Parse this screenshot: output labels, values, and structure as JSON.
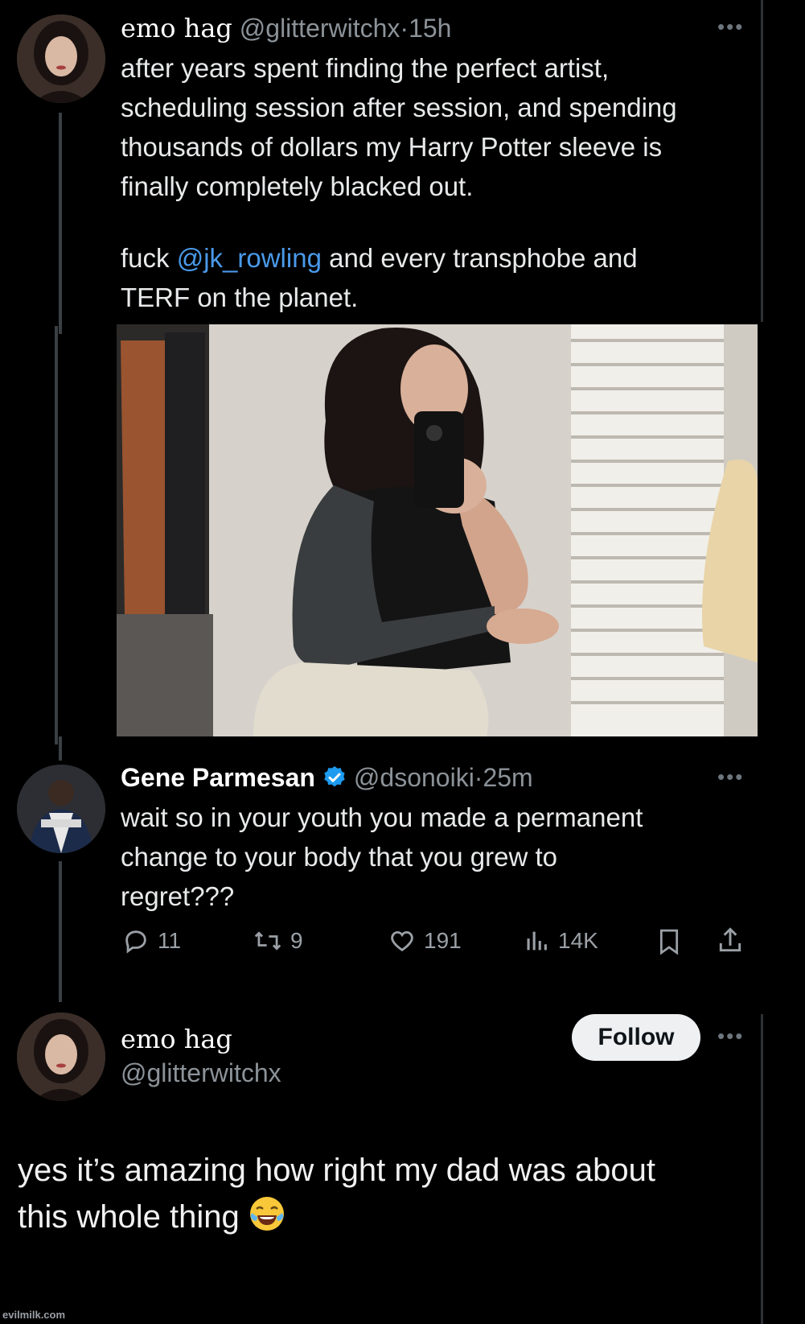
{
  "tweet1": {
    "display_name": "emo hag",
    "handle": "@glitterwitchx",
    "time": "·15h",
    "text_part1": "after years spent finding the perfect artist,\nscheduling session after session, and spending\nthousands of dollars my Harry Potter sleeve is\nfinally completely blacked out.",
    "text_part2_prefix": "fuck ",
    "mention": "@jk_rowling",
    "text_part2_suffix": " and every transphobe and\nTERF on the planet.",
    "more_icon": "more-horizontal-icon"
  },
  "tweet2": {
    "display_name": "Gene Parmesan",
    "handle": "@dsonoiki",
    "time": "·25m",
    "text": "wait so in your youth you made a permanent\nchange to your body that you grew to\nregret???",
    "actions": {
      "replies": "11",
      "retweets": "9",
      "likes": "191",
      "views": "14K"
    }
  },
  "tweet3": {
    "display_name": "emo hag",
    "handle": "@glitterwitchx",
    "follow_label": "Follow",
    "text": "yes it’s amazing how right my dad was about\nthis whole thing"
  },
  "colors": {
    "background": "#000000",
    "text": "#e7e9ea",
    "muted": "#8b9298",
    "link": "#4a99e9",
    "verified": "#1d9bf0"
  },
  "watermark": "evilmilk.com"
}
